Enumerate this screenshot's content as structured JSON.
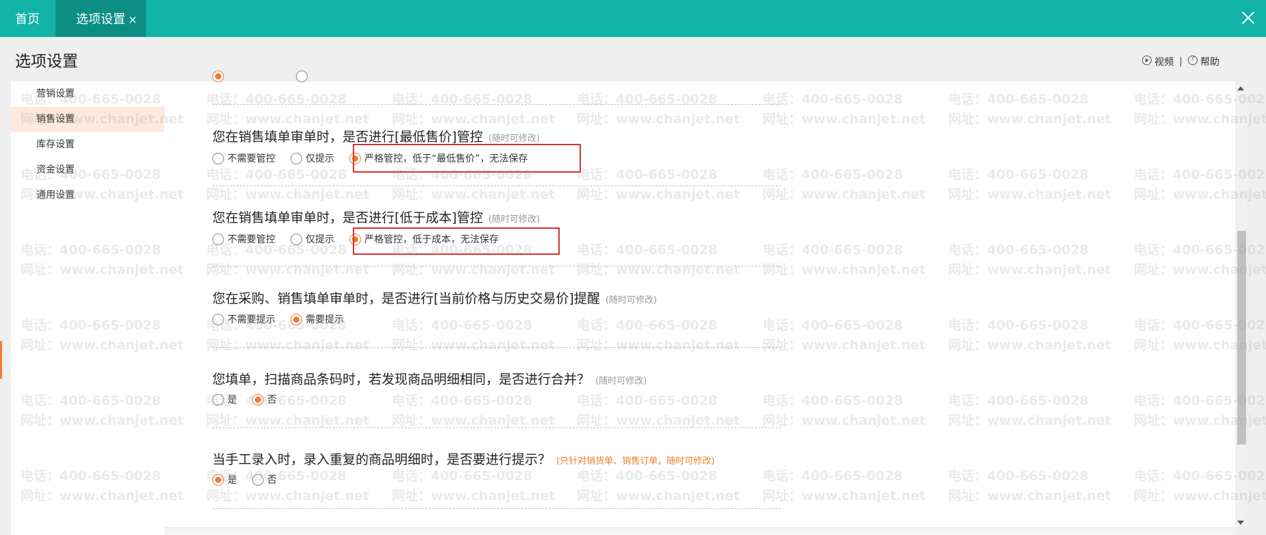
{
  "tabs": {
    "home": "首页",
    "active": "选项设置",
    "close_symbol": "×"
  },
  "page_title": "选项设置",
  "top_links": {
    "video": "视频",
    "separator": "|",
    "help": "帮助"
  },
  "sidebar": {
    "items": [
      {
        "label": "营销设置",
        "active": false
      },
      {
        "label": "销售设置",
        "active": true
      },
      {
        "label": "库存设置",
        "active": false
      },
      {
        "label": "资金设置",
        "active": false
      },
      {
        "label": "通用设置",
        "active": false
      }
    ]
  },
  "settings": [
    {
      "question": "您在销售填单审单时，是否进行[最低售价]管控",
      "hint": "(随时可修改)",
      "options": [
        "不需要管控",
        "仅提示",
        "严格管控，低于“最低售价”，无法保存"
      ],
      "selected": 2,
      "highlighted": true
    },
    {
      "question": "您在销售填单审单时，是否进行[低于成本]管控",
      "hint": "(随时可修改)",
      "options": [
        "不需要管控",
        "仅提示",
        "严格管控，低于成本，无法保存"
      ],
      "selected": 2,
      "highlighted": true
    },
    {
      "question": "您在采购、销售填单审单时，是否进行[当前价格与历史交易价]提醒",
      "hint": "(随时可修改)",
      "options": [
        "不需要提示",
        "需要提示"
      ],
      "selected": 1,
      "highlighted": false
    },
    {
      "question": "您填单，扫描商品条码时，若发现商品明细相同，是否进行合并？",
      "hint": "(随时可修改)",
      "options": [
        "是",
        "否"
      ],
      "selected": 1,
      "highlighted": false
    },
    {
      "question": "当手工录入时，录入重复的商品明细时，是否要进行提示？",
      "hint": "(只针对销货单、销售订单，随时可修改)",
      "options": [
        "是",
        "否"
      ],
      "selected": 0,
      "highlighted": false
    }
  ],
  "watermark": {
    "phone": "电话：400-665-0028",
    "site": "网址：www.chanjet.net"
  },
  "colors": {
    "topbar": "#11b3a6",
    "active_tab": "#0c8e84",
    "accent": "#f07d2e",
    "highlight_box": "#d9302c"
  }
}
